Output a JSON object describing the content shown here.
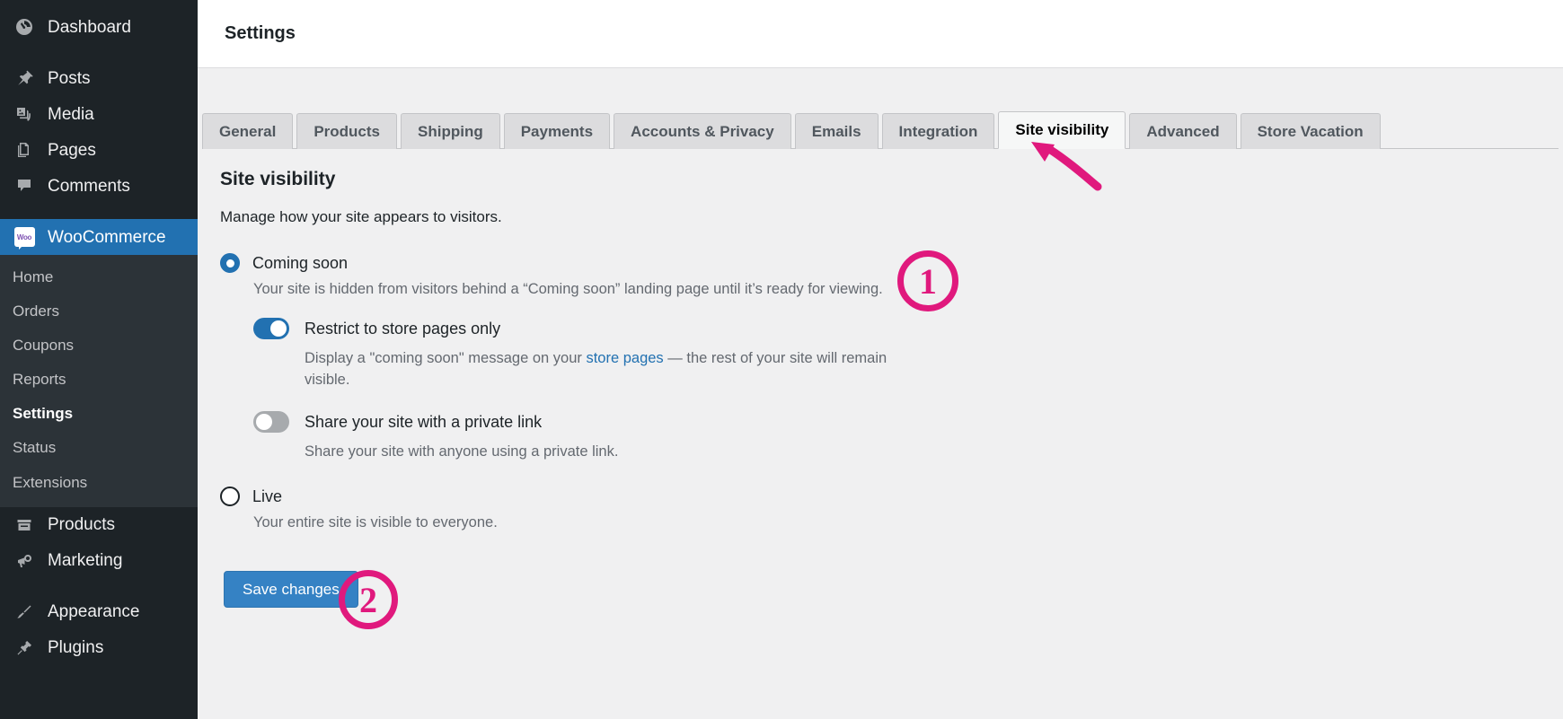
{
  "header": {
    "title": "Settings"
  },
  "sidebar": {
    "top_items": [
      {
        "label": "Dashboard",
        "icon": "dashboard-icon"
      },
      {
        "label": "Posts",
        "icon": "pin-icon"
      },
      {
        "label": "Media",
        "icon": "media-icon"
      },
      {
        "label": "Pages",
        "icon": "pages-icon"
      },
      {
        "label": "Comments",
        "icon": "comment-icon"
      }
    ],
    "current_item": {
      "label": "WooCommerce",
      "icon": "woo-icon",
      "badge_text": "Woo"
    },
    "submenu": [
      {
        "label": "Home",
        "current": false
      },
      {
        "label": "Orders",
        "current": false
      },
      {
        "label": "Coupons",
        "current": false
      },
      {
        "label": "Reports",
        "current": false
      },
      {
        "label": "Settings",
        "current": true
      },
      {
        "label": "Status",
        "current": false
      },
      {
        "label": "Extensions",
        "current": false
      }
    ],
    "bottom_items": [
      {
        "label": "Products",
        "icon": "products-icon"
      },
      {
        "label": "Marketing",
        "icon": "megaphone-icon"
      },
      {
        "label": "Appearance",
        "icon": "brush-icon"
      },
      {
        "label": "Plugins",
        "icon": "plug-icon"
      }
    ]
  },
  "tabs": [
    {
      "label": "General",
      "active": false
    },
    {
      "label": "Products",
      "active": false
    },
    {
      "label": "Shipping",
      "active": false
    },
    {
      "label": "Payments",
      "active": false
    },
    {
      "label": "Accounts & Privacy",
      "active": false
    },
    {
      "label": "Emails",
      "active": false
    },
    {
      "label": "Integration",
      "active": false
    },
    {
      "label": "Site visibility",
      "active": true
    },
    {
      "label": "Advanced",
      "active": false
    },
    {
      "label": "Store Vacation",
      "active": false
    }
  ],
  "main": {
    "section_title": "Site visibility",
    "section_desc": "Manage how your site appears to visitors.",
    "options": {
      "coming_soon": {
        "label": "Coming soon",
        "selected": true,
        "help": "Your site is hidden from visitors behind a “Coming soon” landing page until it’s ready for viewing.",
        "sub_options": [
          {
            "label": "Restrict to store pages only",
            "enabled": true,
            "help_before": "Display a \"coming soon\" message on your ",
            "help_link": "store pages",
            "help_after": " — the rest of your site will remain visible."
          },
          {
            "label": "Share your site with a private link",
            "enabled": false,
            "help_before": "Share your site with anyone using a private link.",
            "help_link": "",
            "help_after": ""
          }
        ]
      },
      "live": {
        "label": "Live",
        "selected": false,
        "help": "Your entire site is visible to everyone."
      }
    },
    "save_label": "Save changes"
  },
  "annotations": {
    "step_1": "1",
    "step_2": "2",
    "color": "#e0197d",
    "arrow_target": "Site visibility"
  },
  "colors": {
    "accent": "#2271b1",
    "button": "#3582c4",
    "sidebar_bg": "#1d2327",
    "submenu_bg": "#2c3338",
    "content_bg": "#f0f0f1",
    "annotation": "#e0197d"
  }
}
